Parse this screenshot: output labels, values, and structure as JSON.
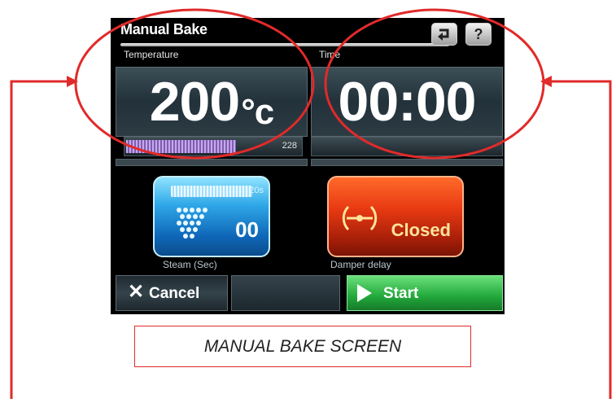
{
  "screen": {
    "title": "Manual Bake",
    "back_button": "back-icon",
    "help_button": "?",
    "temperature": {
      "label": "Temperature",
      "value": "200",
      "unit": "°c",
      "bar_max": "228",
      "bar_fill_fraction": 0.62
    },
    "time": {
      "label": "Time",
      "value": "00:00"
    },
    "steam": {
      "value": "00",
      "bar_max": "20s",
      "label": "Steam (Sec)"
    },
    "damper": {
      "value": "Closed",
      "label": "Damper delay"
    },
    "buttons": {
      "cancel": "Cancel",
      "start": "Start"
    }
  },
  "caption": "MANUAL BAKE SCREEN",
  "colors": {
    "annotation": "#e12a2a",
    "start_green": "#22a83b",
    "steam_blue": "#1f7fd0",
    "damper_red": "#d93412"
  }
}
